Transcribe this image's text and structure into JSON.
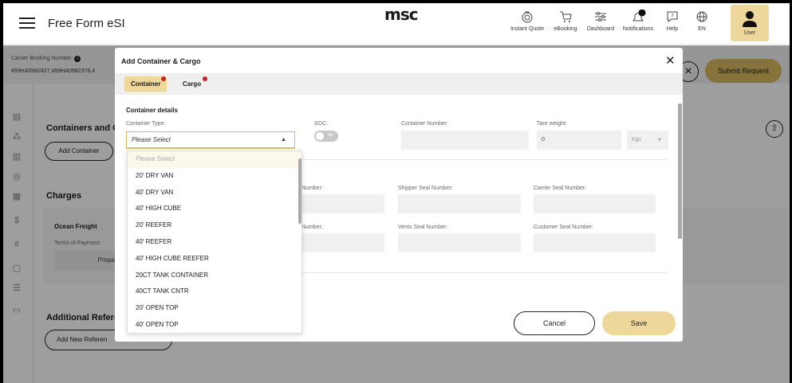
{
  "header": {
    "app_title": "Free Form eSI",
    "logo_text": "msc",
    "nav": [
      {
        "label": "Instant Quote",
        "icon": "instant-quote-icon"
      },
      {
        "label": "eBooking",
        "icon": "cart-icon"
      },
      {
        "label": "Dashboard",
        "icon": "dashboard-icon"
      },
      {
        "label": "Notifications",
        "icon": "bell-icon",
        "badge": "99+"
      },
      {
        "label": "Help",
        "icon": "help-icon"
      },
      {
        "label": "EN",
        "icon": "globe-icon"
      }
    ],
    "user_label": "User"
  },
  "page": {
    "booking_label": "Carrier Booking Number:",
    "booking_value": "459HA0982427,459HA0982378,4",
    "submit_label": "Submit Request",
    "containers_heading": "Containers and C",
    "add_container_label": "Add Container",
    "charges_heading": "Charges",
    "ocean_freight_label": "Ocean Freight",
    "terms_label": "Terms of Payment:",
    "terms_value": "Prepa",
    "additional_heading": "Additional Refere",
    "add_reference_label": "Add New Referen"
  },
  "modal": {
    "title": "Add Container & Cargo",
    "tabs": [
      {
        "label": "Container",
        "active": true,
        "error": true
      },
      {
        "label": "Cargo",
        "active": false,
        "error": true
      }
    ],
    "section_title": "Container details",
    "container_type": {
      "label": "Container Type:",
      "placeholder": "Please Select"
    },
    "soc": {
      "label": "SOC:",
      "value": "No"
    },
    "container_number": {
      "label": "Container Number:",
      "value": ""
    },
    "tare_weight": {
      "label": "Tare weight:",
      "value": "0",
      "unit": "Kgs"
    },
    "row2": {
      "partial_label": "Number:",
      "shipper_seal": "Shipper Seal Number:",
      "carrier_seal": "Carrier Seal Number:"
    },
    "row3": {
      "partial_label": "Number:",
      "vents_seal": "Vents Seal Number:",
      "customer_seal": "Customer Seal Number:"
    },
    "dropdown_options": [
      "Please Select",
      "20' DRY VAN",
      "40' DRY VAN",
      "40' HIGH CUBE",
      "20' REEFER",
      "40' REEFER",
      "40' HIGH CUBE REEFER",
      "20CT TANK CONTAINER",
      "40CT TANK CNTR",
      "20' OPEN TOP",
      "40' OPEN TOP"
    ],
    "cancel_label": "Cancel",
    "save_label": "Save"
  },
  "colors": {
    "accent": "#eed79a",
    "accent_dark": "#d9b85f",
    "error": "#c0262d"
  }
}
